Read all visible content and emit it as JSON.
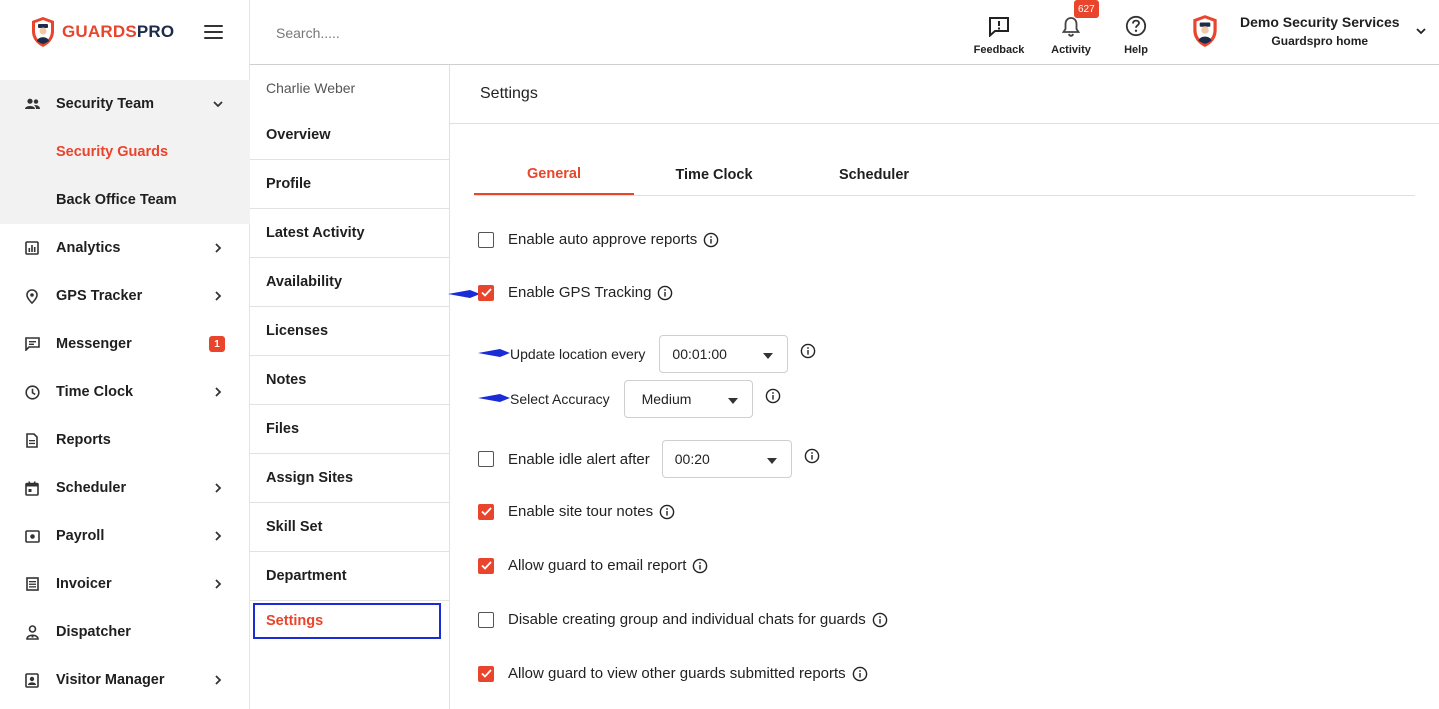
{
  "brand": {
    "name_accent": "GUARDS",
    "name_dark": "PRO"
  },
  "colors": {
    "accent": "#e8452c",
    "dark": "#1d2b4a",
    "highlight": "#1b2bd6"
  },
  "search": {
    "placeholder": "Search....."
  },
  "top_actions": [
    {
      "label": "Feedback",
      "icon": "feedback-icon"
    },
    {
      "label": "Activity",
      "icon": "bell-icon",
      "badge": "627"
    },
    {
      "label": "Help",
      "icon": "help-icon"
    }
  ],
  "user": {
    "company": "Demo Security Services",
    "home": "Guardspro home"
  },
  "sidebar": {
    "items": [
      {
        "label": "Security Team",
        "icon": "team-icon",
        "expanded": true
      },
      {
        "label": "Security Guards"
      },
      {
        "label": "Back Office Team"
      },
      {
        "label": "Analytics",
        "icon": "analytics-icon"
      },
      {
        "label": "GPS Tracker",
        "icon": "location-pin-icon"
      },
      {
        "label": "Messenger",
        "icon": "message-icon",
        "badge": "1"
      },
      {
        "label": "Time Clock",
        "icon": "clock-icon"
      },
      {
        "label": "Reports",
        "icon": "report-icon"
      },
      {
        "label": "Scheduler",
        "icon": "calendar-icon"
      },
      {
        "label": "Payroll",
        "icon": "payroll-icon"
      },
      {
        "label": "Invoicer",
        "icon": "invoice-icon"
      },
      {
        "label": "Dispatcher",
        "icon": "dispatcher-icon"
      },
      {
        "label": "Visitor Manager",
        "icon": "visitor-icon"
      }
    ]
  },
  "guard": {
    "name": "Charlie Weber"
  },
  "subnav": {
    "items": [
      "Overview",
      "Profile",
      "Latest Activity",
      "Availability",
      "Licenses",
      "Notes",
      "Files",
      "Assign Sites",
      "Skill Set",
      "Department",
      "Settings"
    ],
    "active": "Settings"
  },
  "settings": {
    "title": "Settings",
    "tabs": [
      "General",
      "Time Clock",
      "Scheduler"
    ],
    "active_tab": "General",
    "auto_approve": {
      "label": "Enable auto approve reports",
      "checked": false
    },
    "gps": {
      "label": "Enable GPS Tracking",
      "checked": true
    },
    "update_location": {
      "label": "Update location every",
      "value": "00:01:00"
    },
    "accuracy": {
      "label": "Select Accuracy",
      "value": "Medium"
    },
    "idle": {
      "label": "Enable idle alert after",
      "value": "00:20",
      "checked": false
    },
    "site_tour": {
      "label": "Enable site tour notes",
      "checked": true
    },
    "email_report": {
      "label": "Allow guard to email report",
      "checked": true
    },
    "disable_chats": {
      "label": "Disable creating group and individual chats for guards",
      "checked": false
    },
    "view_reports": {
      "label": "Allow guard to view other guards submitted reports",
      "checked": true
    }
  }
}
